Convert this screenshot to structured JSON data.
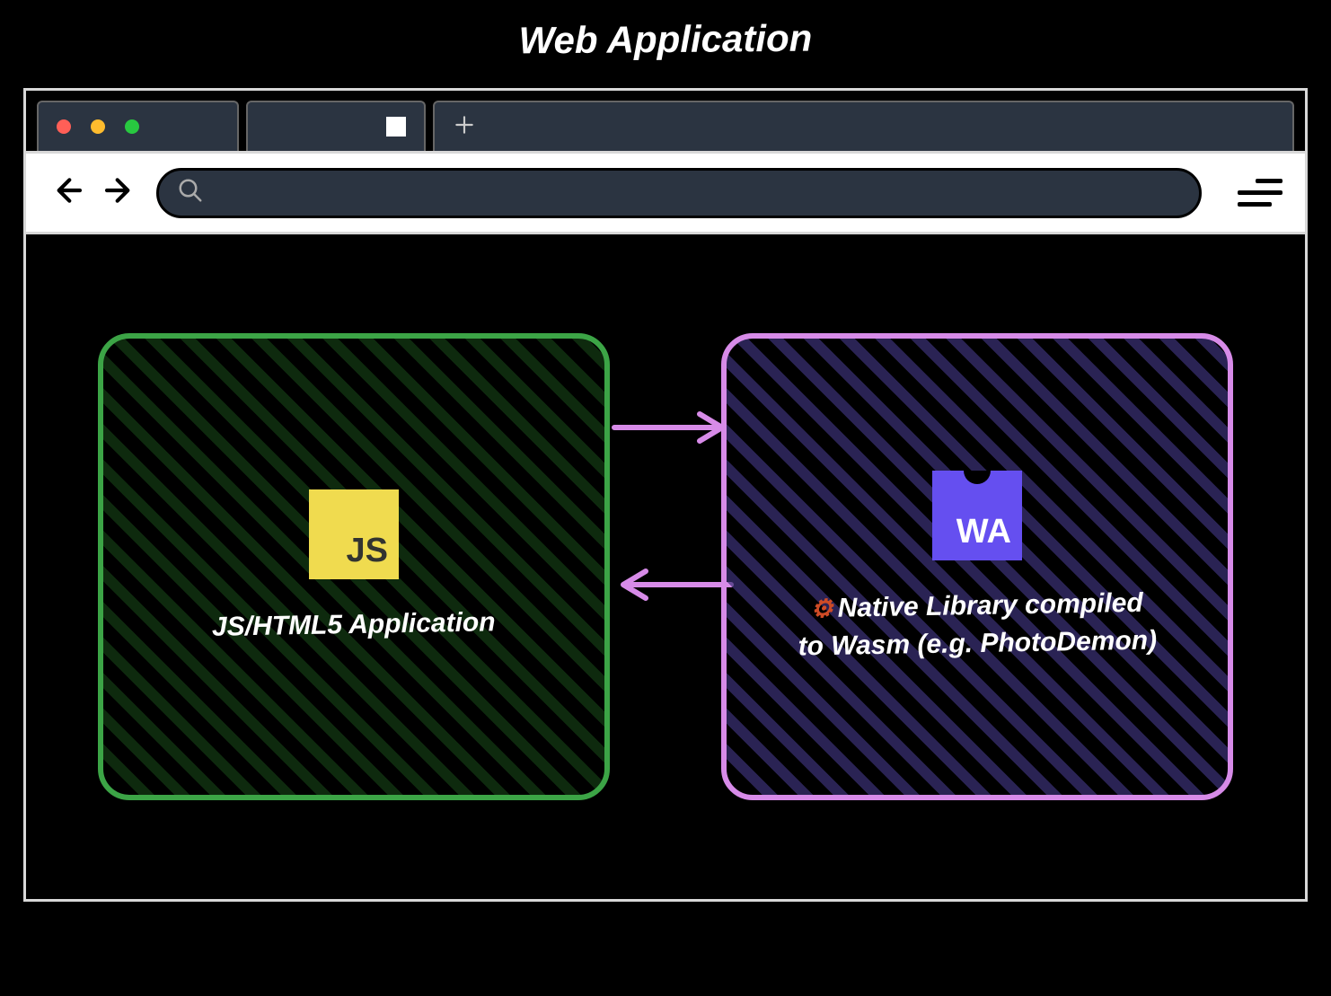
{
  "title": "Web Application",
  "browser": {
    "traffic_lights": [
      "red",
      "yellow",
      "green"
    ],
    "address_value": ""
  },
  "panels": {
    "left": {
      "badge": "JS",
      "label": "JS/HTML5 Application"
    },
    "right": {
      "badge": "WA",
      "rust_symbol": "⚙",
      "label": "Native Library compiled to Wasm (e.g. PhotoDemon)"
    }
  },
  "colors": {
    "green_border": "#3ca446",
    "purple_border": "#d78be8",
    "arrow": "#d78be8",
    "js_bg": "#f0db4f",
    "wa_bg": "#654ff0"
  }
}
